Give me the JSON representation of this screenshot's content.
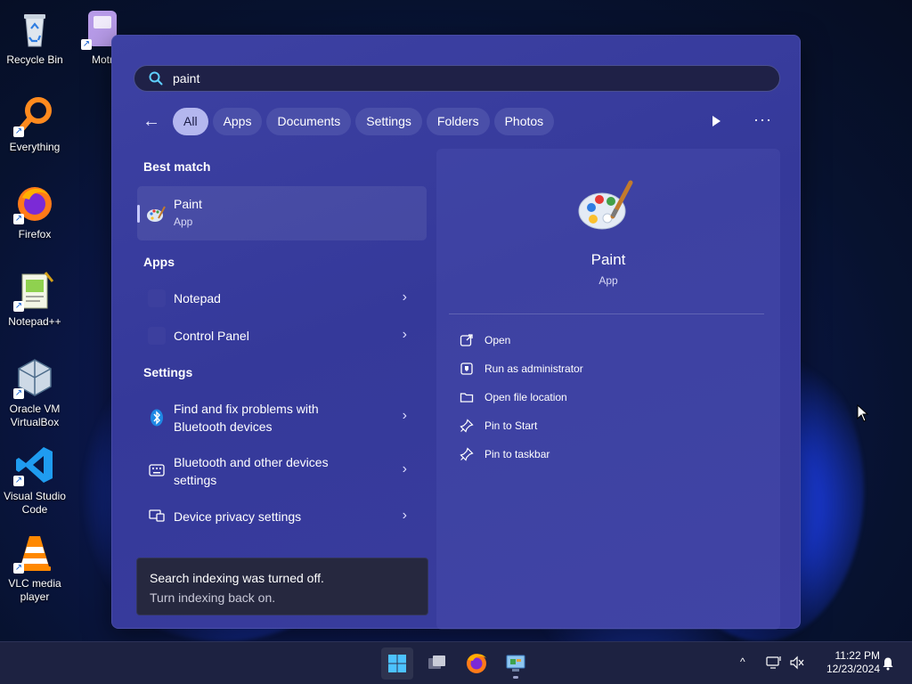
{
  "desktop": {
    "icons": [
      {
        "label": "Recycle Bin",
        "icon": "recycle-bin-icon"
      },
      {
        "label": "Everything",
        "icon": "everything-search-icon"
      },
      {
        "label": "Firefox",
        "icon": "firefox-icon"
      },
      {
        "label": "Notepad++",
        "icon": "notepad-plus-plus-icon"
      },
      {
        "label": "Oracle VM VirtualBox",
        "icon": "virtualbox-icon"
      },
      {
        "label": "Visual Studio Code",
        "icon": "vscode-icon"
      },
      {
        "label": "VLC media player",
        "icon": "vlc-icon"
      },
      {
        "label": "Motr",
        "icon": "app-shortcut-icon"
      }
    ]
  },
  "search": {
    "query": "paint",
    "icon": "search-icon"
  },
  "filters": {
    "back_icon": "back-arrow-icon",
    "chips": [
      "All",
      "Apps",
      "Documents",
      "Settings",
      "Folders",
      "Photos"
    ],
    "active": "All",
    "play_icon": "play-icon",
    "more_label": "···"
  },
  "results": {
    "best_match_heading": "Best match",
    "best_match": {
      "name": "Paint",
      "type": "App",
      "icon": "paint-palette-icon"
    },
    "apps_heading": "Apps",
    "apps": [
      {
        "label": "Notepad"
      },
      {
        "label": "Control Panel"
      }
    ],
    "settings_heading": "Settings",
    "settings": [
      {
        "label_line1": "Find and fix problems with",
        "label_line2": "Bluetooth devices",
        "icon": "bluetooth-icon"
      },
      {
        "label_line1": "Bluetooth and other devices",
        "label_line2": "settings",
        "icon": "keyboard-devices-icon"
      },
      {
        "label_line1": "Device privacy settings",
        "label_line2": "",
        "icon": "device-privacy-icon"
      }
    ],
    "chevron": "›"
  },
  "toast": {
    "title": "Search indexing was turned off.",
    "action": "Turn indexing back on."
  },
  "preview": {
    "name": "Paint",
    "type": "App",
    "actions": [
      {
        "label": "Open",
        "icon": "open-external-icon"
      },
      {
        "label": "Run as administrator",
        "icon": "shield-admin-icon"
      },
      {
        "label": "Open file location",
        "icon": "folder-icon"
      },
      {
        "label": "Pin to Start",
        "icon": "pin-icon"
      },
      {
        "label": "Pin to taskbar",
        "icon": "pin-icon"
      }
    ]
  },
  "taskbar": {
    "items": [
      "start-icon",
      "task-view-icon",
      "firefox-icon",
      "control-panel-icon"
    ],
    "tray_chevron": "^",
    "time": "11:22 PM",
    "date": "12/23/2024"
  },
  "colors": {
    "start_bg": "#3a3d9e",
    "chip_active": "#b4b7ef",
    "taskbar_bg": "#1d2241"
  }
}
